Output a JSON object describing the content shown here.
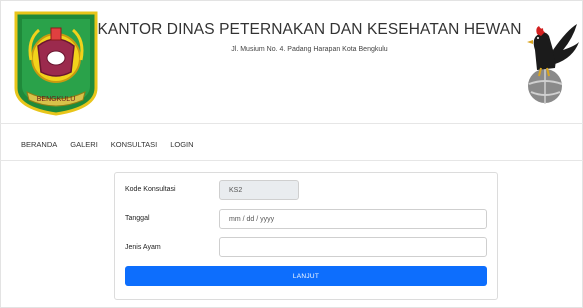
{
  "header": {
    "title": "KANTOR DINAS PETERNAKAN DAN KESEHATAN HEWAN",
    "address": "Jl. Musium No. 4. Padang Harapan Kota Bengkulu",
    "logo_text": "BENGKULU"
  },
  "nav": {
    "items": [
      "BERANDA",
      "GALERI",
      "KONSULTASI",
      "LOGIN"
    ]
  },
  "form": {
    "kode_label": "Kode Konsultasi",
    "kode_value": "KS2",
    "tanggal_label": "Tanggal",
    "tanggal_placeholder": "mm / dd / yyyy",
    "jenis_label": "Jenis Ayam",
    "jenis_value": "",
    "submit_label": "LANJUT"
  },
  "colors": {
    "primary": "#0d6efd",
    "logo_green": "#1f8a3a",
    "logo_yellow": "#f2d21b"
  }
}
